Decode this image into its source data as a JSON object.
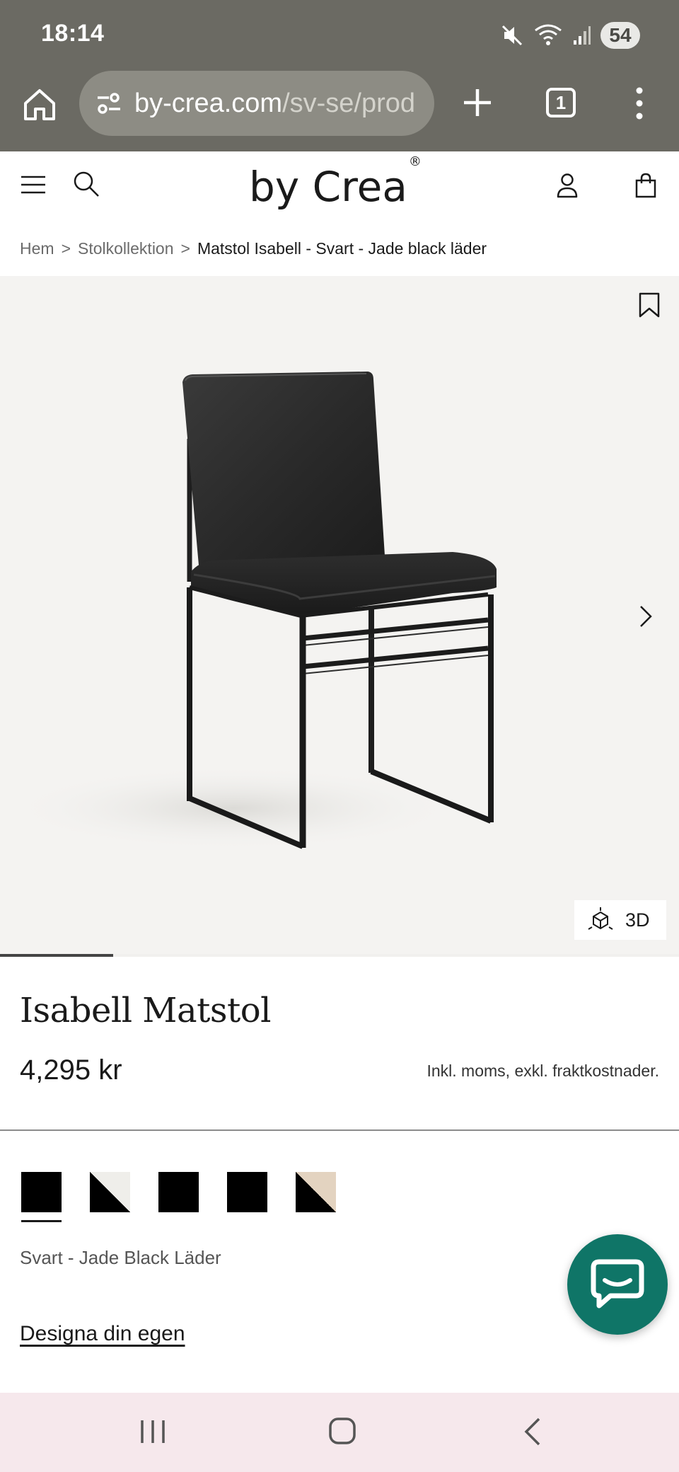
{
  "status_bar": {
    "time": "18:14",
    "battery": "54",
    "icons": [
      "mute-icon",
      "wifi-icon",
      "signal-icon"
    ]
  },
  "browser": {
    "url_domain": "by-crea.com",
    "url_path": "/sv-se/prod",
    "tab_count": "1"
  },
  "header": {
    "logo_text": "by Crea",
    "logo_mark": "®"
  },
  "breadcrumb": {
    "items": [
      "Hem",
      "Stolkollektion"
    ],
    "separator": ">",
    "current": "Matstol Isabell - Svart - Jade black läder"
  },
  "gallery": {
    "button_3d": "3D",
    "progress": 0.167
  },
  "product": {
    "title": "Isabell Matstol",
    "price": "4,295 kr",
    "tax_note": "Inkl. moms, exkl. fraktkostnader.",
    "selected_color": "Svart - Jade Black Läder",
    "design_link": "Designa din egen"
  },
  "swatches": [
    {
      "primary": "#000000",
      "secondary": "#000000",
      "selected": true
    },
    {
      "primary": "#000000",
      "secondary": "#efeeea",
      "selected": false
    },
    {
      "primary": "#000000",
      "secondary": "#000000",
      "selected": false
    },
    {
      "primary": "#000000",
      "secondary": "#000000",
      "selected": false
    },
    {
      "primary": "#000000",
      "secondary": "#e3d3c0",
      "selected": false
    }
  ],
  "colors": {
    "chrome": "#6b6a63",
    "chat_accent": "#0f7567",
    "nav_bg": "#f6e8ec"
  }
}
